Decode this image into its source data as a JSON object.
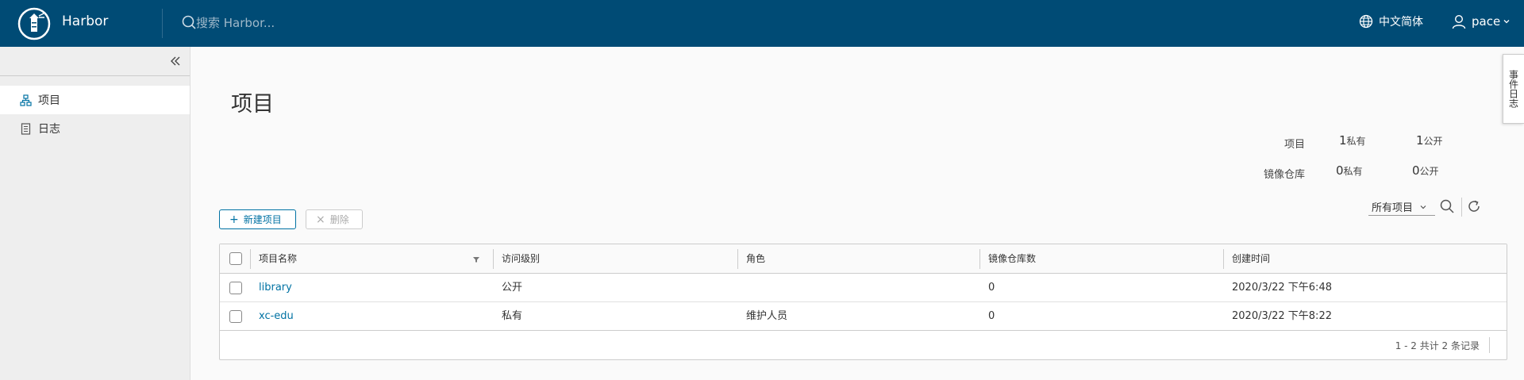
{
  "header": {
    "app_title": "Harbor",
    "search_placeholder": "搜索 Harbor...",
    "language": "中文简体",
    "username": "pace"
  },
  "sidebar": {
    "items": [
      {
        "label": "项目",
        "icon": "projects-icon",
        "active": true
      },
      {
        "label": "日志",
        "icon": "logs-icon",
        "active": false
      }
    ]
  },
  "main": {
    "title": "项目",
    "stats": {
      "projects_label": "项目",
      "repos_label": "镜像仓库",
      "projects_private": "1",
      "projects_public": "1",
      "repos_private": "0",
      "repos_public": "0",
      "private_label": "私有",
      "public_label": "公开"
    },
    "toolbar": {
      "new_label": "新建项目",
      "delete_label": "删除",
      "filter_value": "所有项目"
    },
    "table": {
      "headers": [
        "项目名称",
        "访问级别",
        "角色",
        "镜像仓库数",
        "创建时间"
      ],
      "rows": [
        {
          "name": "library",
          "access": "公开",
          "role": "",
          "repos": "0",
          "created": "2020/3/22 下午6:48"
        },
        {
          "name": "xc-edu",
          "access": "私有",
          "role": "维护人员",
          "repos": "0",
          "created": "2020/3/22 下午8:22"
        }
      ],
      "footer": "1 - 2 共计 2 条记录"
    }
  },
  "event_tab": "事件日志",
  "colors": {
    "header_bg": "#004b75",
    "accent": "#0072a3"
  }
}
